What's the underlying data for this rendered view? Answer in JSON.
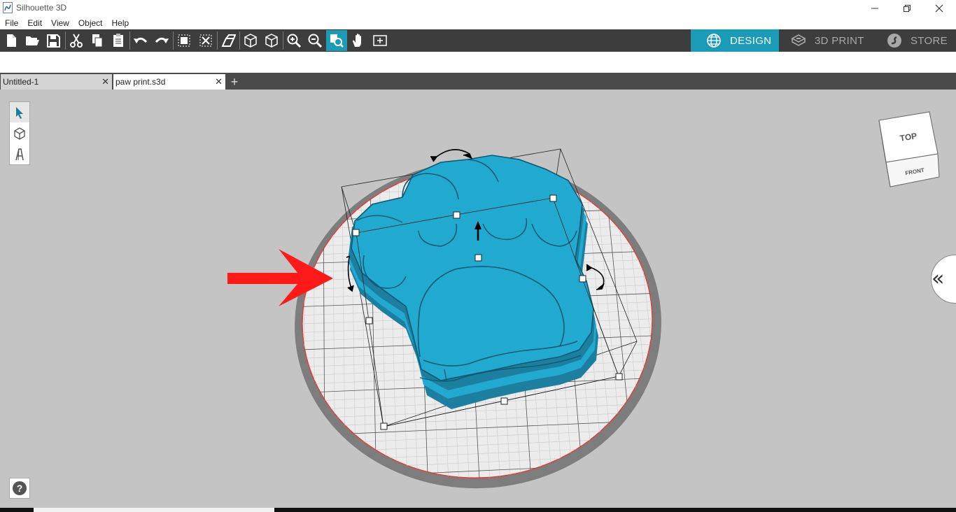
{
  "window": {
    "title": "Silhouette 3D",
    "controls": [
      "minimize",
      "restore",
      "close"
    ]
  },
  "menu": [
    "File",
    "Edit",
    "View",
    "Object",
    "Help"
  ],
  "toolbar": {
    "buttons": [
      "new-document",
      "open-folder",
      "save",
      "cut",
      "copy",
      "paste",
      "undo",
      "redo",
      "group",
      "ungroup",
      "extrude",
      "view-3d",
      "view-iso",
      "zoom-in",
      "zoom-out",
      "zoom-fit",
      "pan",
      "fit-page"
    ],
    "active": "zoom-fit"
  },
  "mode_tabs": {
    "design": "DESIGN",
    "print3d": "3D PRINT",
    "store": "STORE",
    "active": "DESIGN"
  },
  "doc_tabs": [
    {
      "label": "Untitled-1",
      "active": false
    },
    {
      "label": "paw print.s3d",
      "active": true
    }
  ],
  "side_tools": [
    "select-arrow-icon",
    "box-icon",
    "text-icon"
  ],
  "navcube": {
    "top": "TOP",
    "front": "FRONT"
  },
  "colors": {
    "accent": "#1b9bb8",
    "model": "#22a9d0",
    "toolbar": "#3d3d3d",
    "arrow": "#ff1a1a"
  },
  "help": "?"
}
